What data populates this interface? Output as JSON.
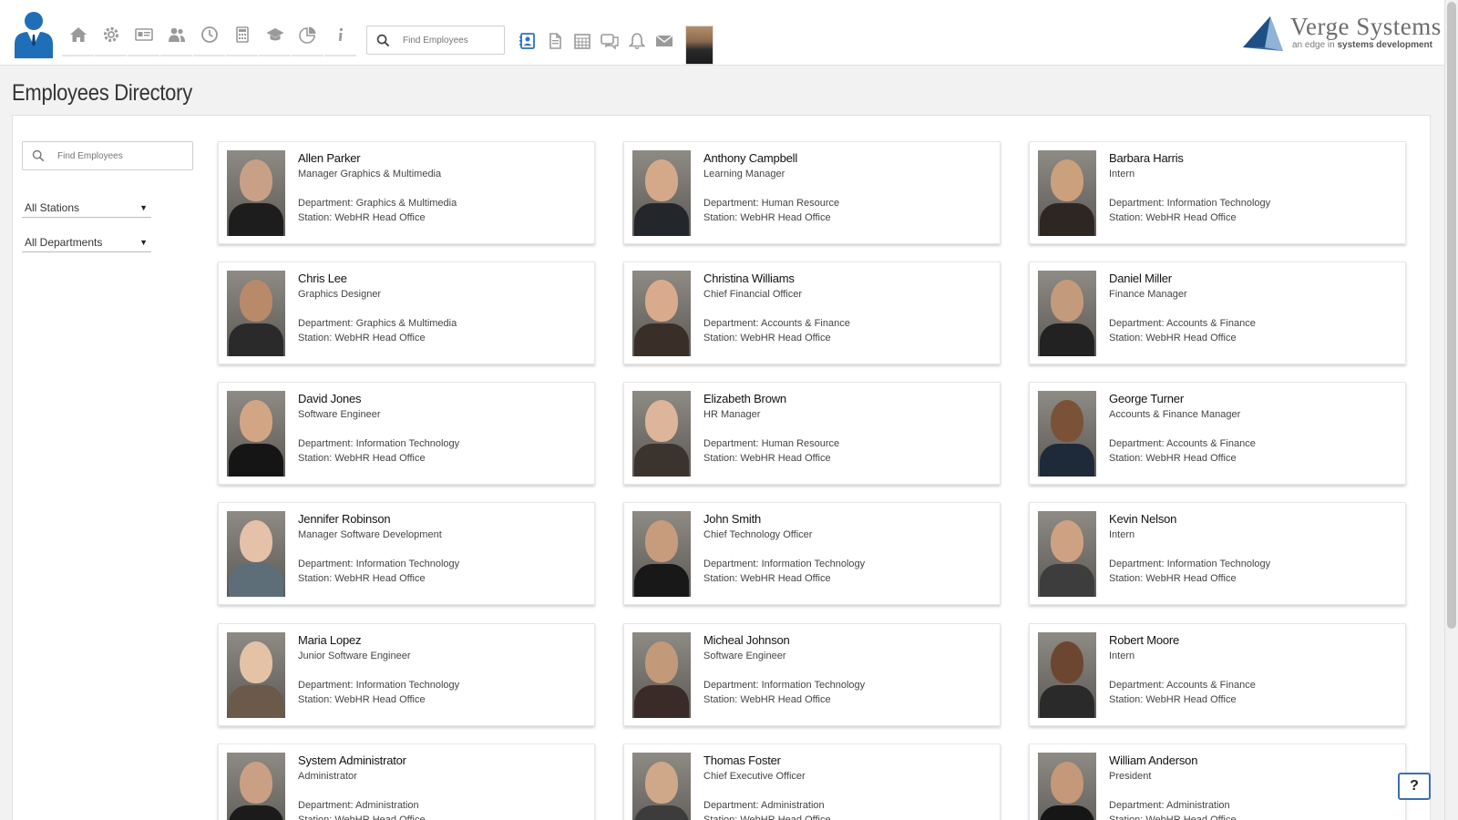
{
  "topbar": {
    "search_placeholder": "Find Employees",
    "nav_icons": [
      "home-icon",
      "gear-icon",
      "id-card-icon",
      "users-icon",
      "clock-icon",
      "calculator-icon",
      "graduation-cap-icon",
      "pie-chart-icon",
      "info-icon"
    ],
    "tool_icons": [
      "directory-icon",
      "document-icon",
      "calendar-icon",
      "chat-icon",
      "bell-icon",
      "mail-icon"
    ],
    "brand": {
      "name": "Verge Systems",
      "tagline_prefix": "an edge in",
      "tagline_strong": "systems development"
    }
  },
  "page": {
    "title": "Employees Directory"
  },
  "filters": {
    "search_placeholder": "Find Employees",
    "stations": "All Stations",
    "departments": "All Departments"
  },
  "employees": [
    {
      "name": "Allen Parker",
      "title": "Manager Graphics & Multimedia",
      "department": "Department: Graphics & Multimedia",
      "station": "Station: WebHR Head Office"
    },
    {
      "name": "Anthony Campbell",
      "title": "Learning Manager",
      "department": "Department: Human Resource",
      "station": "Station: WebHR Head Office"
    },
    {
      "name": "Barbara Harris",
      "title": "Intern",
      "department": "Department: Information Technology",
      "station": "Station: WebHR Head Office"
    },
    {
      "name": "Chris Lee",
      "title": "Graphics Designer",
      "department": "Department: Graphics & Multimedia",
      "station": "Station: WebHR Head Office"
    },
    {
      "name": "Christina Williams",
      "title": "Chief Financial Officer",
      "department": "Department: Accounts & Finance",
      "station": "Station: WebHR Head Office"
    },
    {
      "name": "Daniel Miller",
      "title": "Finance Manager",
      "department": "Department: Accounts & Finance",
      "station": "Station: WebHR Head Office"
    },
    {
      "name": "David Jones",
      "title": "Software Engineer",
      "department": "Department: Information Technology",
      "station": "Station: WebHR Head Office"
    },
    {
      "name": "Elizabeth Brown",
      "title": "HR Manager",
      "department": "Department: Human Resource",
      "station": "Station: WebHR Head Office"
    },
    {
      "name": "George Turner",
      "title": "Accounts & Finance Manager",
      "department": "Department: Accounts & Finance",
      "station": "Station: WebHR Head Office"
    },
    {
      "name": "Jennifer Robinson",
      "title": "Manager Software Development",
      "department": "Department: Information Technology",
      "station": "Station: WebHR Head Office"
    },
    {
      "name": "John Smith",
      "title": "Chief Technology Officer",
      "department": "Department: Information Technology",
      "station": "Station: WebHR Head Office"
    },
    {
      "name": "Kevin Nelson",
      "title": "Intern",
      "department": "Department: Information Technology",
      "station": "Station: WebHR Head Office"
    },
    {
      "name": "Maria Lopez",
      "title": "Junior Software Engineer",
      "department": "Department: Information Technology",
      "station": "Station: WebHR Head Office"
    },
    {
      "name": "Micheal Johnson",
      "title": "Software Engineer",
      "department": "Department: Information Technology",
      "station": "Station: WebHR Head Office"
    },
    {
      "name": "Robert Moore",
      "title": "Intern",
      "department": "Department: Accounts & Finance",
      "station": "Station: WebHR Head Office"
    },
    {
      "name": "System Administrator",
      "title": "Administrator",
      "department": "Department: Administration",
      "station": "Station: WebHR Head Office"
    },
    {
      "name": "Thomas Foster",
      "title": "Chief Executive Officer",
      "department": "Department: Administration",
      "station": "Station: WebHR Head Office"
    },
    {
      "name": "William Anderson",
      "title": "President",
      "department": "Department: Administration",
      "station": "Station: WebHR Head Office"
    }
  ],
  "help": {
    "label": "?"
  }
}
